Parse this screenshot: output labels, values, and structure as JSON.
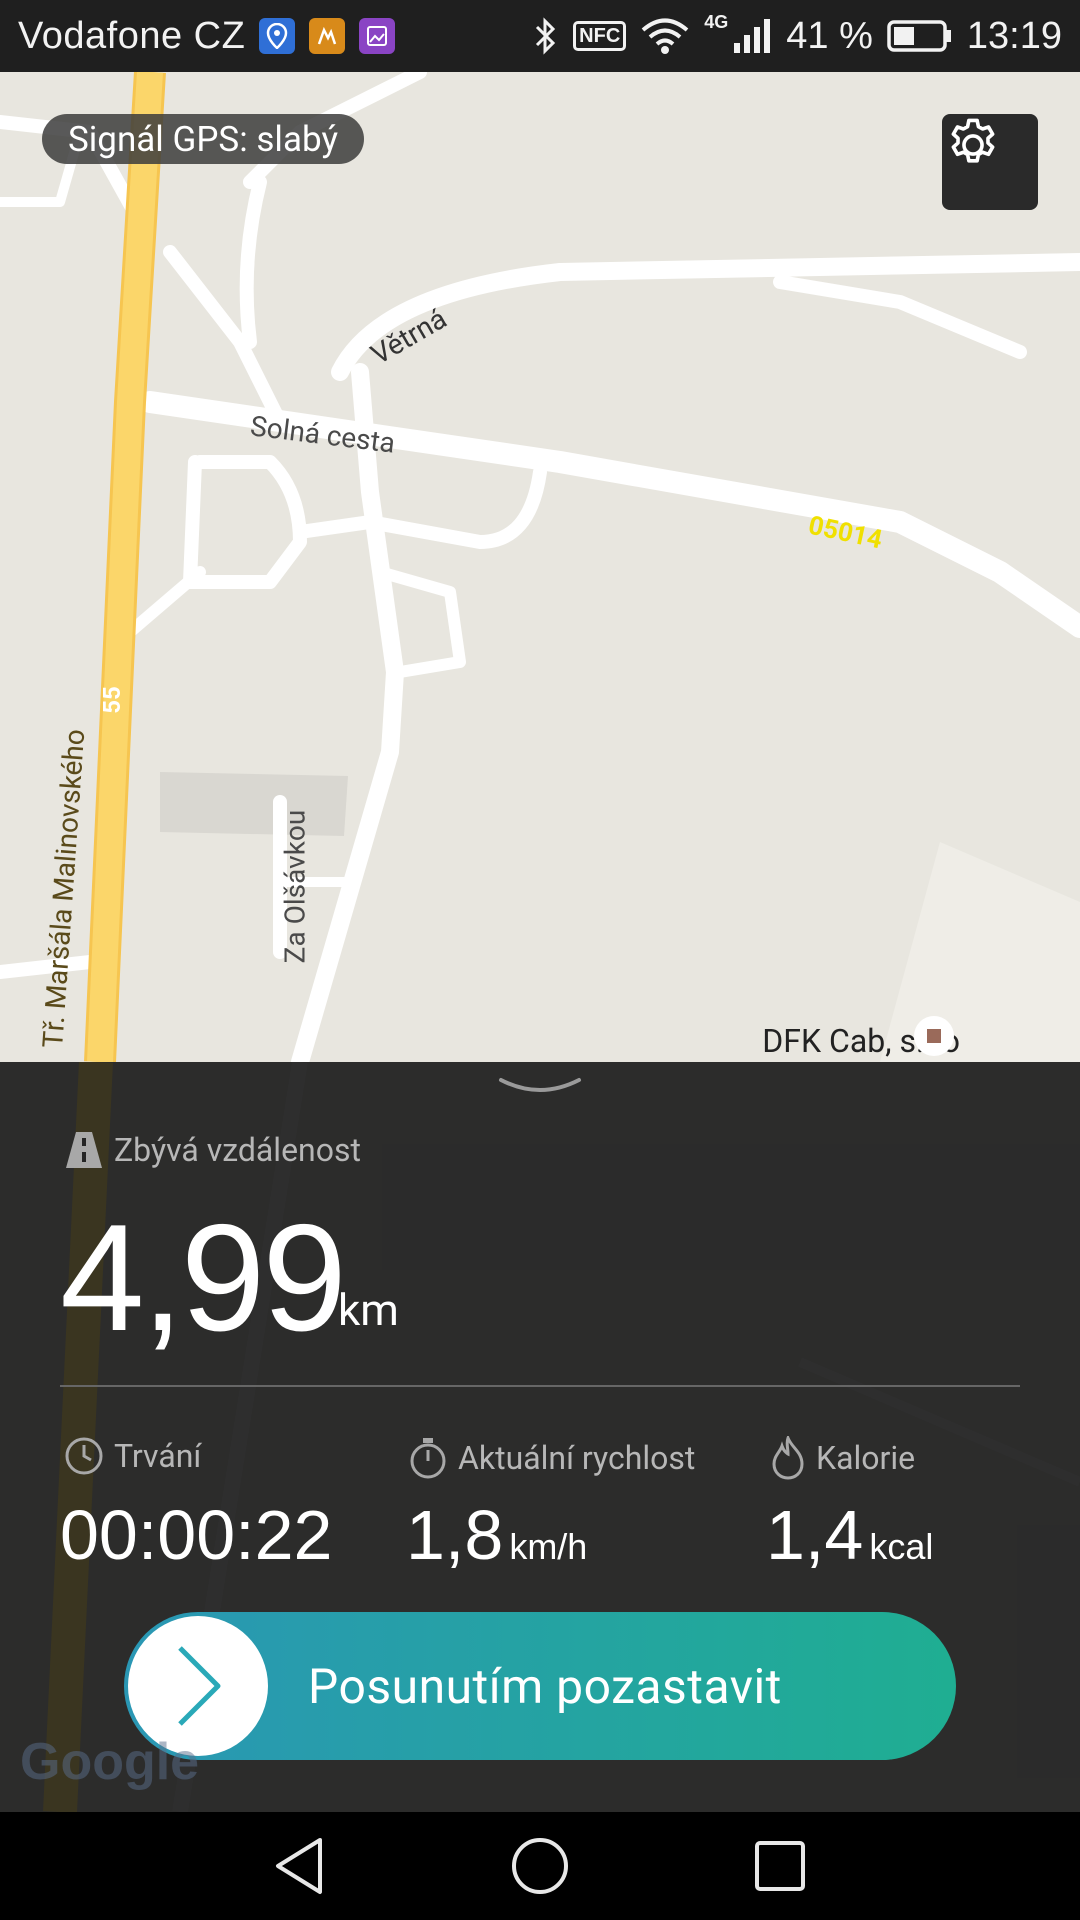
{
  "status_bar": {
    "carrier": "Vodafone CZ",
    "network": "4G",
    "nfc_label": "NFC",
    "battery": "41 %",
    "time": "13:19"
  },
  "map": {
    "gps_signal": "Signál GPS: slabý",
    "street_labels": {
      "vetrna": "Větrná",
      "solna": "Solná cesta",
      "road_code": "05014",
      "route_55": "55",
      "marsala": "Tř. Maršála Malinovského",
      "olsavkou": "Za Olšávkou"
    },
    "poi_label": "DFK Cab, s.r.o",
    "provider": "Google"
  },
  "workout": {
    "remaining_label": "Zbývá vzdálenost",
    "remaining_value": "4,99",
    "remaining_unit": "km",
    "duration_label": "Trvání",
    "duration_value": "00:00:22",
    "speed_label": "Aktuální rychlost",
    "speed_value": "1,8",
    "speed_unit": "km/h",
    "calories_label": "Kalorie",
    "calories_value": "1,4",
    "calories_unit": "kcal",
    "slider_label": "Posunutím pozastavit"
  },
  "colors": {
    "accent_start": "#2a97b4",
    "accent_end": "#1fae92",
    "panel_bg": "#252525"
  }
}
